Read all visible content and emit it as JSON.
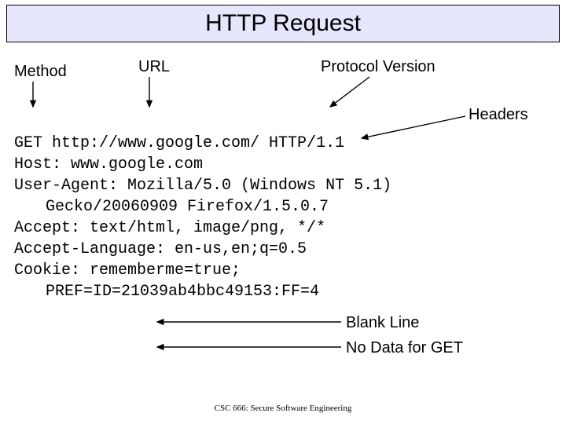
{
  "title": "HTTP Request",
  "labels": {
    "method": "Method",
    "url": "URL",
    "protocol": "Protocol Version",
    "headers": "Headers",
    "blank_line": "Blank Line",
    "no_data": "No Data for GET"
  },
  "code": {
    "line1": "GET http://www.google.com/ HTTP/1.1",
    "line2": "Host: www.google.com",
    "line3": "User-Agent: Mozilla/5.0 (Windows NT 5.1)",
    "line3b": "Gecko/20060909 Firefox/1.5.0.7",
    "line4": "Accept: text/html, image/png, */*",
    "line5": "Accept-Language: en-us,en;q=0.5",
    "line6": "Cookie: rememberme=true;",
    "line6b": "PREF=ID=21039ab4bbc49153:FF=4"
  },
  "footer": "CSC 666: Secure Software Engineering"
}
